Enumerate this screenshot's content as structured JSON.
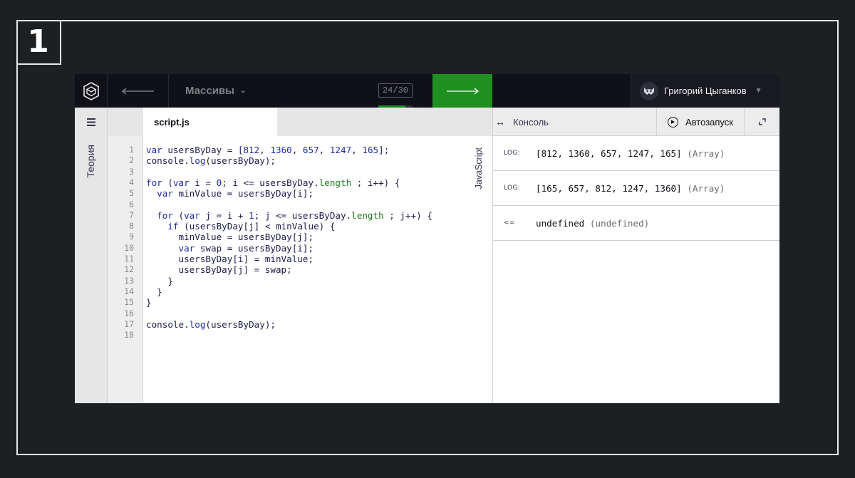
{
  "badge": "1",
  "topbar": {
    "lesson_title": "Массивы",
    "progress": "24/30",
    "progress_fraction": 0.8,
    "user_name": "Григорий Цыганков"
  },
  "theory": {
    "label": "Теория"
  },
  "editor": {
    "tab": "script.js",
    "language": "JavaScript",
    "line_numbers": [
      "1",
      "2",
      "3",
      "4",
      "5",
      "6",
      "7",
      "8",
      "9",
      "10",
      "11",
      "12",
      "13",
      "14",
      "15",
      "16",
      "17",
      "18"
    ],
    "lines": [
      "var usersByDay = [812, 1360, 657, 1247, 165];",
      "console.log(usersByDay);",
      "",
      "for (var i = 0; i <= usersByDay.length ; i++) {",
      "  var minValue = usersByDay[i];",
      "",
      "  for (var j = i + 1; j <= usersByDay.length ; j++) {",
      "    if (usersByDay[j] < minValue) {",
      "      minValue = usersByDay[j];",
      "      var swap = usersByDay[i];",
      "      usersByDay[i] = minValue;",
      "      usersByDay[j] = swap;",
      "    }",
      "  }",
      "}",
      "",
      "console.log(usersByDay);",
      ""
    ]
  },
  "console": {
    "title": "Консоль",
    "autorun_label": "Автозапуск",
    "entries": [
      {
        "kind": "LOG:",
        "value": "[812, 1360, 657, 1247, 165]",
        "type": "(Array)"
      },
      {
        "kind": "LOG:",
        "value": "[165, 657, 812, 1247, 1360]",
        "type": "(Array)"
      },
      {
        "kind": "<=",
        "value": "undefined",
        "type": "(undefined)"
      }
    ]
  },
  "colors": {
    "next_button": "#1f8f1f",
    "topbar": "#101018",
    "page_bg": "#1c2022"
  }
}
